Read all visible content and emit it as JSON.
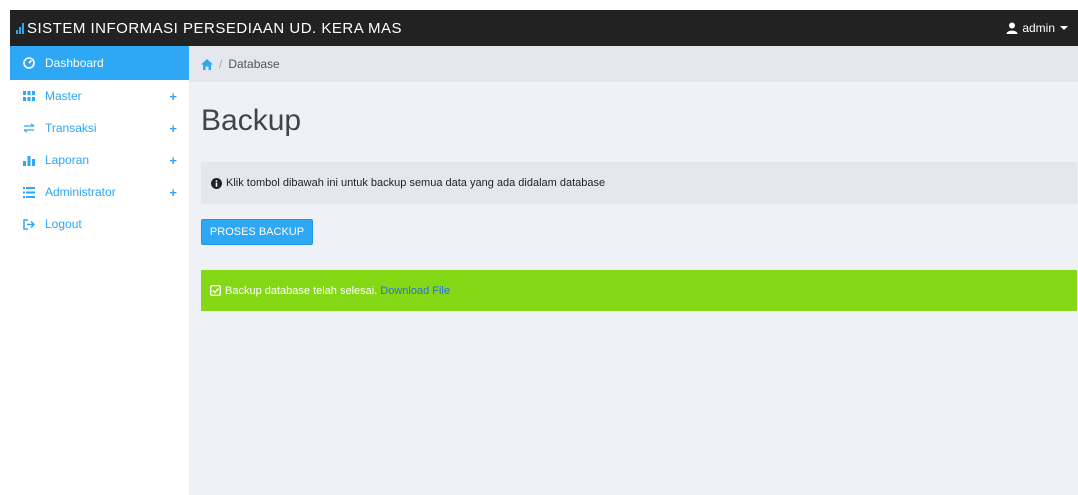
{
  "app": {
    "title": "SISTEM INFORMASI PERSEDIAAN UD. KERA MAS",
    "user": "admin"
  },
  "sidebar": {
    "items": [
      {
        "label": "Dashboard",
        "icon": "dashboard-icon"
      },
      {
        "label": "Master",
        "icon": "grid-icon",
        "expand": "+"
      },
      {
        "label": "Transaksi",
        "icon": "exchange-icon",
        "expand": "+"
      },
      {
        "label": "Laporan",
        "icon": "bar-chart-icon",
        "expand": "+"
      },
      {
        "label": "Administrator",
        "icon": "list-icon",
        "expand": "+"
      },
      {
        "label": "Logout",
        "icon": "logout-icon"
      }
    ]
  },
  "breadcrumb": {
    "current": "Database"
  },
  "main": {
    "title": "Backup",
    "info_text": "Klik tombol dibawah ini untuk backup semua data yang ada didalam database",
    "button_label": "PROSES BACKUP",
    "success_text": "Backup database telah selesai.",
    "download_label": "Download File"
  },
  "colors": {
    "accent": "#2ea7f5",
    "navbar": "#222222",
    "success": "#84d816",
    "link": "#2a6fe0"
  }
}
